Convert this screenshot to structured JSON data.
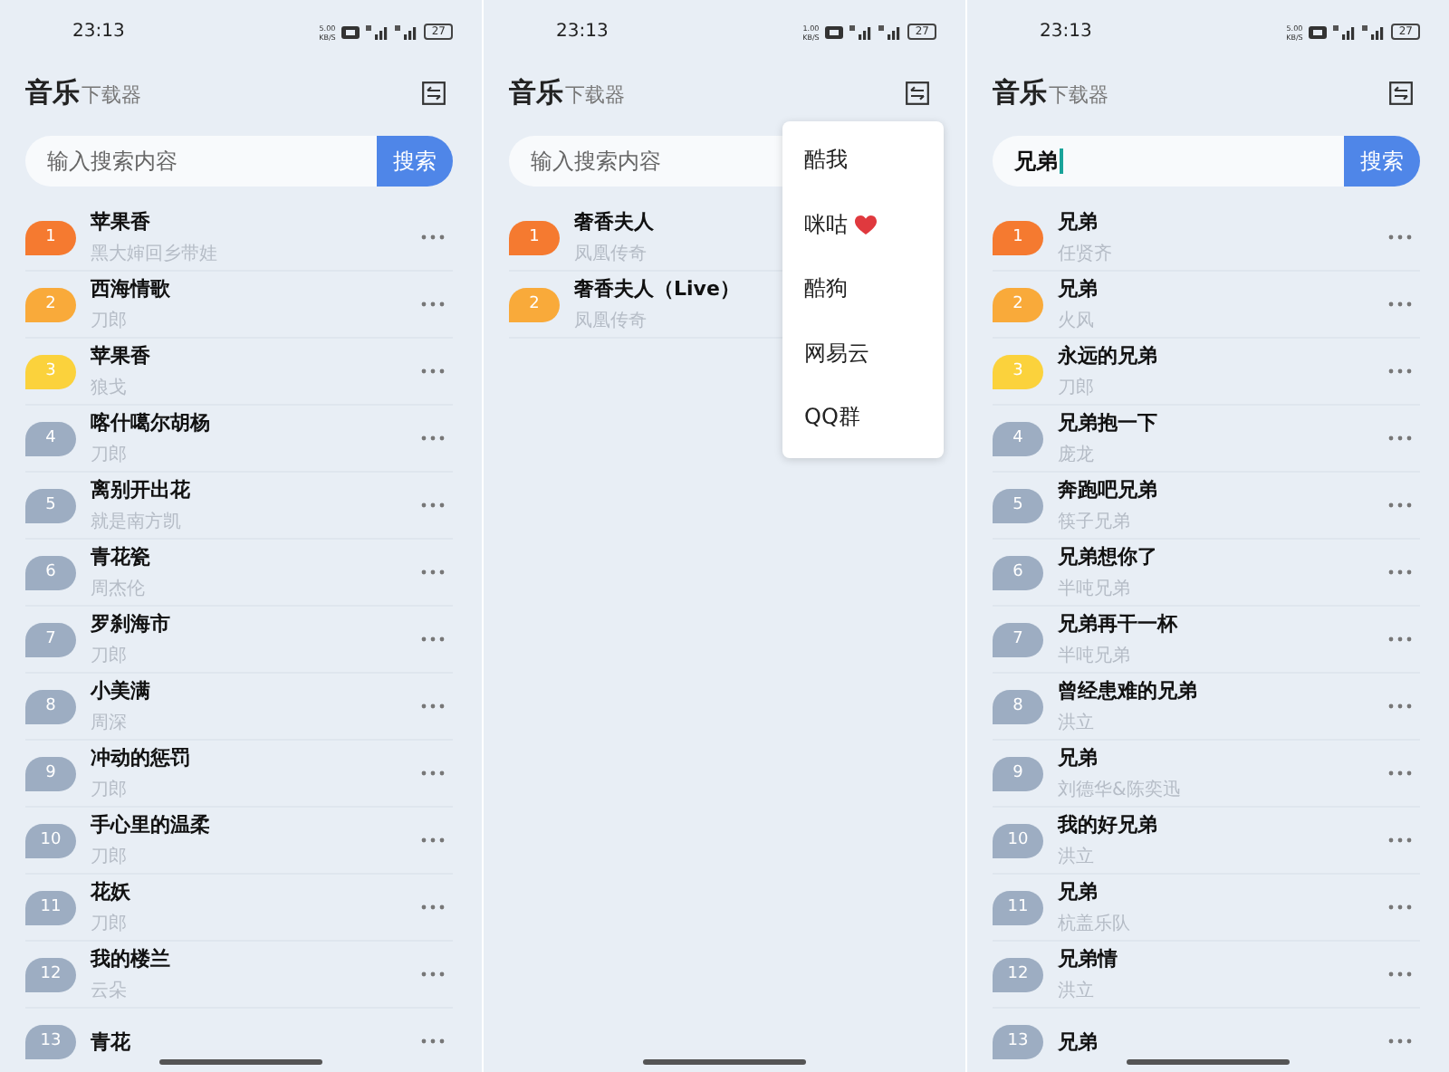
{
  "screens": [
    {
      "status_bar": {
        "time": "23:13",
        "speed": "5.00",
        "speed_unit": "KB/S",
        "battery": "27"
      },
      "header": {
        "title": "音乐",
        "subtitle": "下载器"
      },
      "search": {
        "placeholder": "输入搜索内容",
        "button": "搜索"
      },
      "songs": [
        {
          "rank": "1",
          "title": "苹果香",
          "artist": "黑大婶回乡带娃",
          "color": "#f57a30",
          "more": true
        },
        {
          "rank": "2",
          "title": "西海情歌",
          "artist": "刀郎",
          "color": "#f9aa3a",
          "more": true
        },
        {
          "rank": "3",
          "title": "苹果香",
          "artist": "狼戈",
          "color": "#fbd23c",
          "more": true
        },
        {
          "rank": "4",
          "title": "喀什噶尔胡杨",
          "artist": "刀郎",
          "color": "#9dadc2",
          "more": true
        },
        {
          "rank": "5",
          "title": "离别开出花",
          "artist": "就是南方凯",
          "color": "#9dadc2",
          "more": true
        },
        {
          "rank": "6",
          "title": "青花瓷",
          "artist": "周杰伦",
          "color": "#9dadc2",
          "more": true
        },
        {
          "rank": "7",
          "title": "罗刹海市",
          "artist": "刀郎",
          "color": "#9dadc2",
          "more": true
        },
        {
          "rank": "8",
          "title": "小美满",
          "artist": "周深",
          "color": "#9dadc2",
          "more": true
        },
        {
          "rank": "9",
          "title": "冲动的惩罚",
          "artist": "刀郎",
          "color": "#9dadc2",
          "more": true
        },
        {
          "rank": "10",
          "title": "手心里的温柔",
          "artist": "刀郎",
          "color": "#9dadc2",
          "more": true
        },
        {
          "rank": "11",
          "title": "花妖",
          "artist": "刀郎",
          "color": "#9dadc2",
          "more": true
        },
        {
          "rank": "12",
          "title": "我的楼兰",
          "artist": "云朵",
          "color": "#9dadc2",
          "more": true
        },
        {
          "rank": "13",
          "title": "青花",
          "color": "#9dadc2",
          "more": true
        }
      ]
    },
    {
      "status_bar": {
        "time": "23:13",
        "speed": "1.00",
        "speed_unit": "KB/S",
        "battery": "27"
      },
      "header": {
        "title": "音乐",
        "subtitle": "下载器"
      },
      "search": {
        "placeholder": "输入搜索内容"
      },
      "songs": [
        {
          "rank": "1",
          "title": "奢香夫人",
          "artist": "凤凰传奇",
          "color": "#f57a30",
          "more": false
        },
        {
          "rank": "2",
          "title": "奢香夫人（Live）",
          "artist": "凤凰传奇",
          "color": "#f9aa3a",
          "more": false
        }
      ],
      "menu": [
        {
          "label": "酷我",
          "heart": false
        },
        {
          "label": "咪咕",
          "heart": true
        },
        {
          "label": "酷狗",
          "heart": false
        },
        {
          "label": "网易云",
          "heart": false
        },
        {
          "label": "QQ群",
          "heart": false
        }
      ]
    },
    {
      "status_bar": {
        "time": "23:13",
        "speed": "5.00",
        "speed_unit": "KB/S",
        "battery": "27"
      },
      "header": {
        "title": "音乐",
        "subtitle": "下载器"
      },
      "search": {
        "value": "兄弟",
        "button": "搜索"
      },
      "songs": [
        {
          "rank": "1",
          "title": "兄弟",
          "artist": "任贤齐",
          "color": "#f57a30",
          "more": true
        },
        {
          "rank": "2",
          "title": "兄弟",
          "artist": "火风",
          "color": "#f9aa3a",
          "more": true
        },
        {
          "rank": "3",
          "title": "永远的兄弟",
          "artist": "刀郎",
          "color": "#fbd23c",
          "more": true
        },
        {
          "rank": "4",
          "title": "兄弟抱一下",
          "artist": "庞龙",
          "color": "#9dadc2",
          "more": true
        },
        {
          "rank": "5",
          "title": "奔跑吧兄弟",
          "artist": "筷子兄弟",
          "color": "#9dadc2",
          "more": true
        },
        {
          "rank": "6",
          "title": "兄弟想你了",
          "artist": "半吨兄弟",
          "color": "#9dadc2",
          "more": true
        },
        {
          "rank": "7",
          "title": "兄弟再干一杯",
          "artist": "半吨兄弟",
          "color": "#9dadc2",
          "more": true
        },
        {
          "rank": "8",
          "title": "曾经患难的兄弟",
          "artist": "洪立",
          "color": "#9dadc2",
          "more": true
        },
        {
          "rank": "9",
          "title": "兄弟",
          "artist": "刘德华&陈奕迅",
          "color": "#9dadc2",
          "more": true
        },
        {
          "rank": "10",
          "title": "我的好兄弟",
          "artist": "洪立",
          "color": "#9dadc2",
          "more": true
        },
        {
          "rank": "11",
          "title": "兄弟",
          "artist": "杭盖乐队",
          "color": "#9dadc2",
          "more": true
        },
        {
          "rank": "12",
          "title": "兄弟情",
          "artist": "洪立",
          "color": "#9dadc2",
          "more": true
        },
        {
          "rank": "13",
          "title": "兄弟",
          "color": "#9dadc2",
          "more": true
        }
      ]
    }
  ]
}
